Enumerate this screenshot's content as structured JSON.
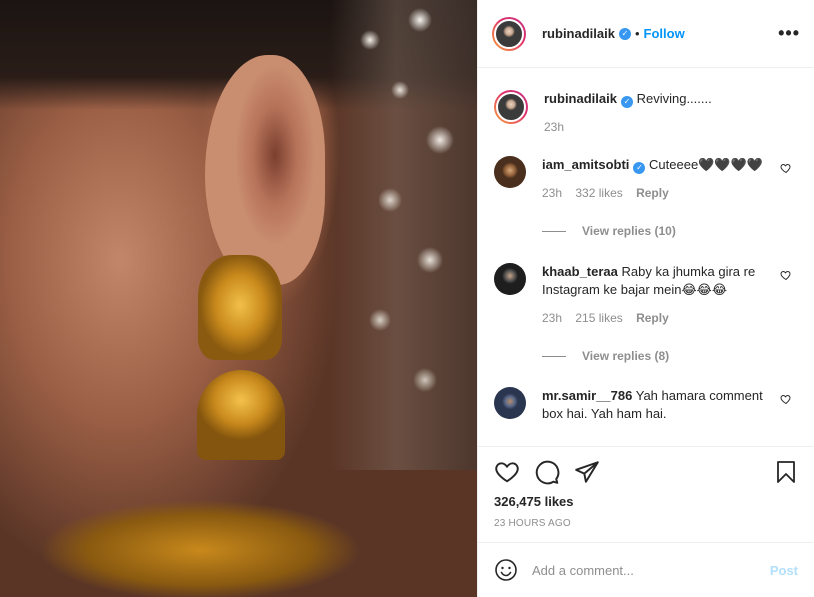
{
  "post": {
    "username": "rubinadilaik",
    "follow_label": "Follow",
    "dot": "•",
    "more": "•••",
    "caption_text": "Reviving.......",
    "caption_time": "23h",
    "likes": "326,475 likes",
    "posted_ago": "23 HOURS AGO"
  },
  "comments": [
    {
      "username": "iam_amitsobti",
      "text": "Cuteeee🖤🖤🖤🖤",
      "time": "23h",
      "likes": "332 likes",
      "reply_label": "Reply",
      "view_replies": "View replies (10)"
    },
    {
      "username": "khaab_teraa",
      "text": "Raby ka jhumka gira re Instagram ke bajar mein😂😂😂",
      "time": "23h",
      "likes": "215 likes",
      "reply_label": "Reply",
      "view_replies": "View replies (8)"
    },
    {
      "username": "mr.samir__786",
      "text": "Yah hamara comment box hai. Yah ham hai."
    }
  ],
  "composer": {
    "placeholder": "Add a comment...",
    "post_label": "Post"
  },
  "icons": {
    "like": "heart-icon",
    "comment": "comment-icon",
    "share": "share-icon",
    "save": "bookmark-icon",
    "emoji": "emoji-icon",
    "verified": "verified-badge-icon"
  },
  "colors": {
    "accent": "#0095f6",
    "verified": "#3897f0",
    "muted": "#8e8e8e",
    "post_disabled": "#b2dffc"
  }
}
